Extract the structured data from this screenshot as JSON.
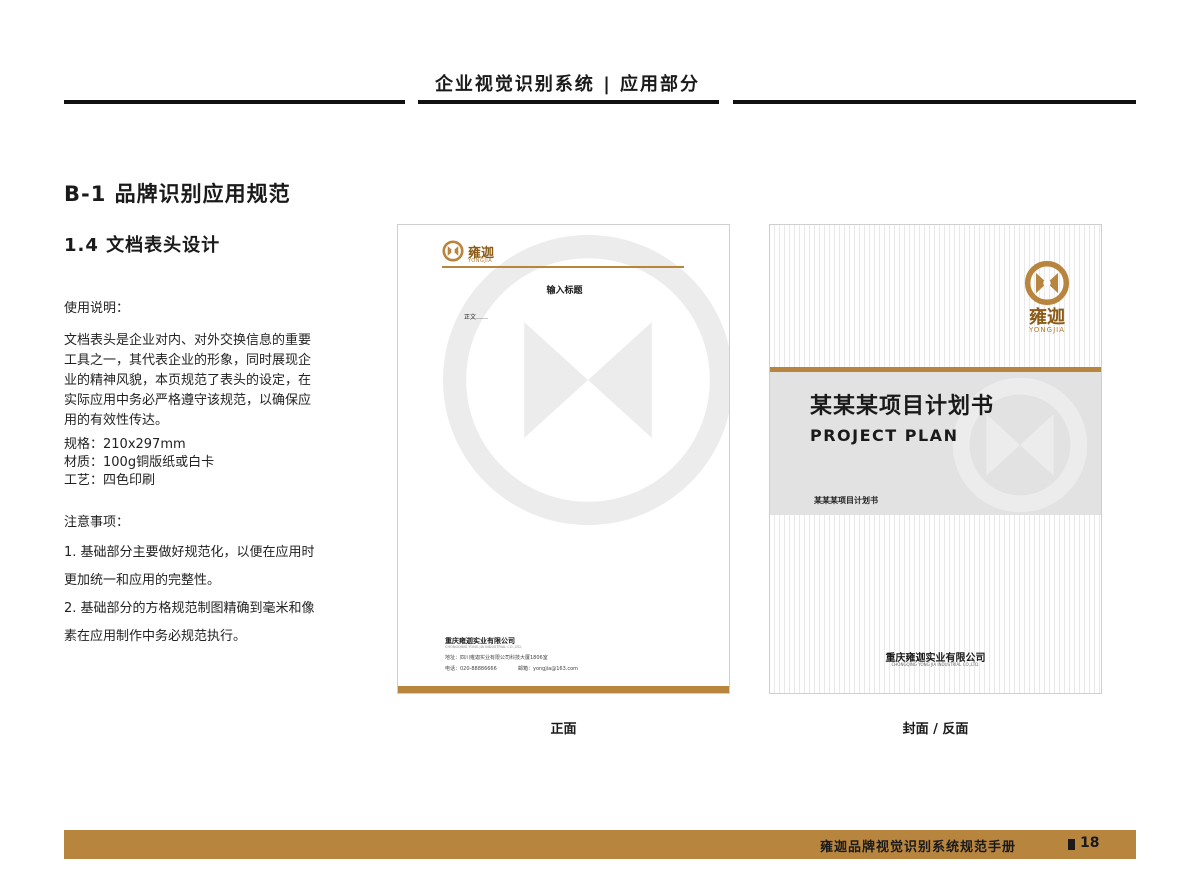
{
  "header": {
    "title": "企业视觉识别系统 | 应用部分"
  },
  "section": {
    "title": "B-1  品牌识别应用规范",
    "subtitle": "1.4  文档表头设计"
  },
  "usage": {
    "heading": "使用说明：",
    "paragraph": [
      "文档表头是企业对内、对外交换信息的重要",
      "工具之一，其代表企业的形象，同时展现企",
      "业的精神风貌，本页规范了表头的设定，在",
      "实际应用中务必严格遵守该规范，以确保应",
      "用的有效性传达。"
    ],
    "specs": [
      "规格：210x297mm",
      "材质：100g铜版纸或白卡",
      "工艺：四色印刷"
    ]
  },
  "notes": {
    "heading": "注意事项：",
    "lines": [
      "1. 基础部分主要做好规范化，以便在应用时",
      "更加统一和应用的完整性。",
      "2. 基础部分的方格规范制图精确到毫米和像",
      "素在应用制作中务必规范执行。"
    ]
  },
  "front_page": {
    "logo_text": "雍迦",
    "logo_sub": "YONGJIA",
    "heading": "输入标题",
    "body": "正文……",
    "company": "重庆雍迦实业有限公司",
    "company_en": "CHONGQING YONG JIA INDUSTRIAL CO.,LTD.",
    "address": "地址：四川雍迦实业有限公司科技大厦1806室",
    "tel": "电话：020-88886666",
    "email": "邮箱：yongjia@163.com",
    "caption": "正面"
  },
  "cover_page": {
    "logo_text": "雍迦",
    "logo_sub": "YONGJIA",
    "title": "某某某项目计划书",
    "title_en": "PROJECT PLAN",
    "subtitle": "某某某项目计划书",
    "company": "重庆雍迦实业有限公司",
    "company_en": "CHONGQING YONG JIA INDUSTRIAL CO.,LTD.",
    "caption": "封面 / 反面"
  },
  "footer": {
    "title": "雍迦品牌视觉识别系统规范手册",
    "page": "18"
  },
  "colors": {
    "accent": "#b8853f",
    "text": "#1a1a1a",
    "rule": "#111111"
  }
}
